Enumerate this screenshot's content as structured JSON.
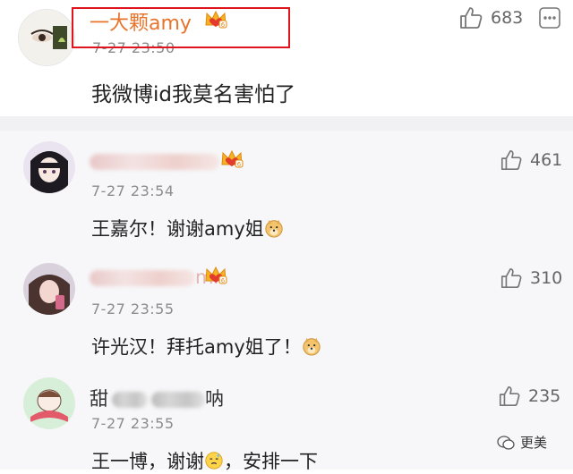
{
  "main_comment": {
    "username": "一大颗amy",
    "time": "7-27 23:50",
    "text": "我微博id我莫名害怕了",
    "likes": "683"
  },
  "replies": [
    {
      "username_visible": "",
      "time": "7-27 23:54",
      "text": "王嘉尔！谢谢amy姐",
      "likes": "461"
    },
    {
      "username_visible": "mi",
      "time": "7-27 23:55",
      "text": "许光汉！拜托amy姐了！",
      "likes": "310"
    },
    {
      "username_visible": "甜 呐",
      "time": "7-27 23:55",
      "text": "王一博，谢谢",
      "text_tail": "，安排一下",
      "likes": "235"
    }
  ],
  "watermark": {
    "label": "更美"
  },
  "colors": {
    "username": "#e8742c",
    "highlight": "#e0141c",
    "crown": "#f5b322"
  },
  "icons": [
    "thumbs-up-icon",
    "more-icon",
    "crown-icon",
    "doge-emoji",
    "sweat-emoji",
    "wechat-icon"
  ]
}
